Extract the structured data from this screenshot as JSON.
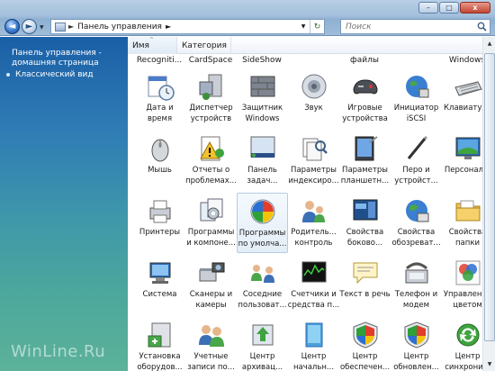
{
  "window": {
    "minimize_glyph": "–",
    "maximize_glyph": "□",
    "close_glyph": "x"
  },
  "nav": {
    "back_glyph": "◄",
    "forward_glyph": "►",
    "dropdown_glyph": "▼"
  },
  "address": {
    "separator": "►",
    "crumb": "Панель управления",
    "crumb_sep": "►",
    "dropdown_glyph": "▼",
    "refresh_glyph": "↻"
  },
  "search": {
    "placeholder": "Поиск"
  },
  "left": {
    "home_link": "Панель управления - домашняя страница",
    "classic_view": "Классический вид",
    "watermark": "WinLine.Ru"
  },
  "columns": {
    "name": "Имя",
    "category": "Категория"
  },
  "top_partial": [
    "Recogniti...",
    "CardSpace",
    "SideShow",
    "",
    "файлы",
    "",
    "Windows"
  ],
  "items": [
    {
      "label": "Дата и\nвремя",
      "icon": "calendar-clock-icon"
    },
    {
      "label": "Диспетчер\nустройств",
      "icon": "device-manager-icon"
    },
    {
      "label": "Защитник\nWindows",
      "icon": "windows-defender-icon"
    },
    {
      "label": "Звук",
      "icon": "speaker-icon"
    },
    {
      "label": "Игровые\nустройства",
      "icon": "gamepad-icon"
    },
    {
      "label": "Инициатор\niSCSI",
      "icon": "globe-network-icon"
    },
    {
      "label": "Клавиатура",
      "icon": "keyboard-icon"
    },
    {
      "label": "Мышь",
      "icon": "mouse-icon"
    },
    {
      "label": "Отчеты о\nпроблемах...",
      "icon": "problem-reports-icon"
    },
    {
      "label": "Панель\nзадач...",
      "icon": "taskbar-icon"
    },
    {
      "label": "Параметры\nиндексиро...",
      "icon": "indexing-icon"
    },
    {
      "label": "Параметры\nпланшетн...",
      "icon": "tablet-icon"
    },
    {
      "label": "Перо и\nустройст...",
      "icon": "pen-icon"
    },
    {
      "label": "Персонал...",
      "icon": "personalization-icon"
    },
    {
      "label": "Принтеры",
      "icon": "printer-icon"
    },
    {
      "label": "Программы\nи компоне...",
      "icon": "programs-features-icon"
    },
    {
      "label": "Программы\nпо умолча...",
      "icon": "default-programs-icon"
    },
    {
      "label": "Родитель...\nконтроль",
      "icon": "parental-controls-icon"
    },
    {
      "label": "Свойства\nбоково...",
      "icon": "sidebar-properties-icon"
    },
    {
      "label": "Свойства\nобозреват...",
      "icon": "internet-options-icon"
    },
    {
      "label": "Свойства\nпапки",
      "icon": "folder-options-icon"
    },
    {
      "label": "Система",
      "icon": "system-icon"
    },
    {
      "label": "Сканеры и\nкамеры",
      "icon": "scanner-camera-icon"
    },
    {
      "label": "Соседние\nпользоват...",
      "icon": "people-near-me-icon"
    },
    {
      "label": "Счетчики и\nсредства п...",
      "icon": "performance-icon"
    },
    {
      "label": "Текст в речь",
      "icon": "speech-bubble-icon"
    },
    {
      "label": "Телефон и\nмодем",
      "icon": "phone-modem-icon"
    },
    {
      "label": "Управление\nцветом",
      "icon": "color-management-icon"
    },
    {
      "label": "Установка\nоборудов...",
      "icon": "add-hardware-icon"
    },
    {
      "label": "Учетные\nзаписи по...",
      "icon": "user-accounts-icon"
    },
    {
      "label": "Центр\nархивац...",
      "icon": "backup-center-icon"
    },
    {
      "label": "Центр\nначальн...",
      "icon": "welcome-center-icon"
    },
    {
      "label": "Центр\nобеспечен...",
      "icon": "security-center-icon"
    },
    {
      "label": "Центр\nобновлен...",
      "icon": "windows-update-icon"
    },
    {
      "label": "Центр\nсинхрони...",
      "icon": "sync-center-icon"
    }
  ],
  "selected_item": "Программы\nпо умолча...",
  "scroll": {
    "up_glyph": "▲",
    "down_glyph": "▼"
  }
}
